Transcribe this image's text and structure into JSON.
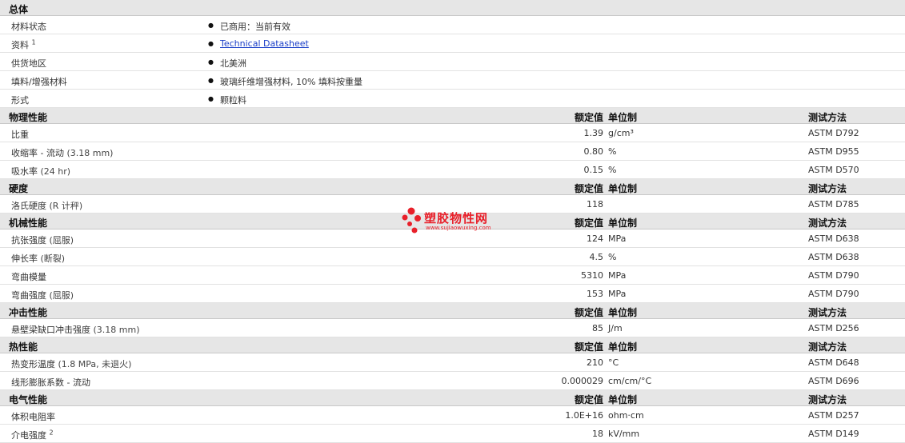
{
  "sections": [
    {
      "title": "总体",
      "kind": "general",
      "rows": [
        {
          "name": "材料状态",
          "value": "已商用：当前有效"
        },
        {
          "name": "资料",
          "sup": "1",
          "value": "Technical Datasheet",
          "link": true
        },
        {
          "name": "供货地区",
          "value": "北美洲"
        },
        {
          "name": "填料/增强材料",
          "value": "玻璃纤维增强材料, 10% 填料按重量"
        },
        {
          "name": "形式",
          "value": "颗粒料"
        }
      ]
    },
    {
      "title": "物理性能",
      "kind": "props",
      "value_header": "额定值",
      "unit_header": "单位制",
      "method_header": "测试方法",
      "rows": [
        {
          "name": "比重",
          "cond": "",
          "value": "1.39",
          "unit": "g/cm³",
          "method": "ASTM D792"
        },
        {
          "name": "收缩率 - 流动",
          "cond": "(3.18 mm)",
          "value": "0.80",
          "unit": "%",
          "method": "ASTM D955"
        },
        {
          "name": "吸水率",
          "cond": "(24 hr)",
          "value": "0.15",
          "unit": "%",
          "method": "ASTM D570"
        }
      ]
    },
    {
      "title": "硬度",
      "kind": "props",
      "value_header": "额定值",
      "unit_header": "单位制",
      "method_header": "测试方法",
      "rows": [
        {
          "name": "洛氏硬度",
          "cond": "(R 计秤)",
          "value": "118",
          "unit": "",
          "method": "ASTM D785"
        }
      ]
    },
    {
      "title": "机械性能",
      "kind": "props",
      "value_header": "额定值",
      "unit_header": "单位制",
      "method_header": "测试方法",
      "rows": [
        {
          "name": "抗张强度",
          "cond": "(屈服)",
          "value": "124",
          "unit": "MPa",
          "method": "ASTM D638"
        },
        {
          "name": "伸长率",
          "cond": "(断裂)",
          "value": "4.5",
          "unit": "%",
          "method": "ASTM D638"
        },
        {
          "name": "弯曲模量",
          "cond": "",
          "value": "5310",
          "unit": "MPa",
          "method": "ASTM D790"
        },
        {
          "name": "弯曲强度",
          "cond": "(屈服)",
          "value": "153",
          "unit": "MPa",
          "method": "ASTM D790"
        }
      ]
    },
    {
      "title": "冲击性能",
      "kind": "props",
      "value_header": "额定值",
      "unit_header": "单位制",
      "method_header": "测试方法",
      "rows": [
        {
          "name": "悬壁梁缺口冲击强度",
          "cond": "(3.18 mm)",
          "value": "85",
          "unit": "J/m",
          "method": "ASTM D256"
        }
      ]
    },
    {
      "title": "热性能",
      "kind": "props",
      "value_header": "额定值",
      "unit_header": "单位制",
      "method_header": "测试方法",
      "rows": [
        {
          "name": "热变形温度",
          "cond": "(1.8 MPa, 未退火)",
          "value": "210",
          "unit": "°C",
          "method": "ASTM D648"
        },
        {
          "name": "线形膨胀系数 - 流动",
          "cond": "",
          "value": "0.000029",
          "unit": "cm/cm/°C",
          "method": "ASTM D696"
        }
      ]
    },
    {
      "title": "电气性能",
      "kind": "props",
      "value_header": "额定值",
      "unit_header": "单位制",
      "method_header": "测试方法",
      "rows": [
        {
          "name": "体积电阻率",
          "cond": "",
          "value": "1.0E+16",
          "unit": "ohm·cm",
          "method": "ASTM D257"
        },
        {
          "name": "介电强度",
          "sup": "2",
          "cond": "",
          "value": "18",
          "unit": "kV/mm",
          "method": "ASTM D149"
        }
      ]
    }
  ],
  "watermark": {
    "text": "塑胶物性网",
    "url": "www.sujiaowuxing.com",
    "color": "#e8202a"
  }
}
